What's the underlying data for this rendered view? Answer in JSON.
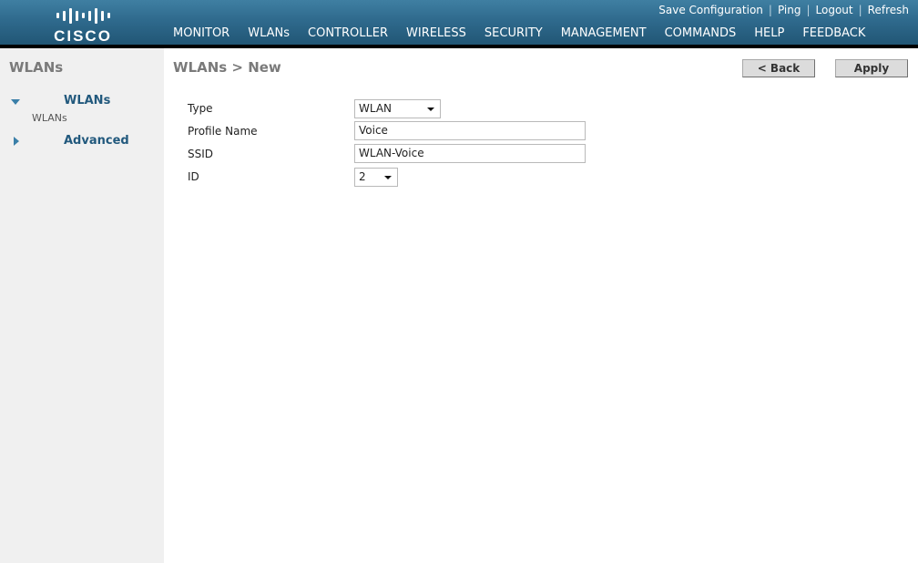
{
  "brand": {
    "logo_text": "CISCO"
  },
  "utility_links": [
    "Save Configuration",
    "Ping",
    "Logout",
    "Refresh"
  ],
  "nav": {
    "items": [
      "MONITOR",
      "WLANs",
      "CONTROLLER",
      "WIRELESS",
      "SECURITY",
      "MANAGEMENT",
      "COMMANDS",
      "HELP",
      "FEEDBACK"
    ],
    "active": "WLANs"
  },
  "sidebar": {
    "title": "WLANs",
    "tree": [
      {
        "label": "WLANs",
        "expanded": true,
        "children": [
          "WLANs"
        ]
      },
      {
        "label": "Advanced",
        "expanded": false
      }
    ]
  },
  "page": {
    "title": "WLANs > New",
    "buttons": {
      "back": "< Back",
      "apply": "Apply"
    }
  },
  "form": {
    "type": {
      "label": "Type",
      "value": "WLAN"
    },
    "profile_name": {
      "label": "Profile Name",
      "value": "Voice"
    },
    "ssid": {
      "label": "SSID",
      "value": "WLAN-Voice"
    },
    "id": {
      "label": "ID",
      "value": "2"
    }
  },
  "colors": {
    "header_top": "#3f7fa2",
    "header_bottom": "#215675",
    "active_tab_underline": "#f5a623",
    "sidebar_link": "#22597d",
    "sidebar_bg": "#f0f0f0"
  }
}
